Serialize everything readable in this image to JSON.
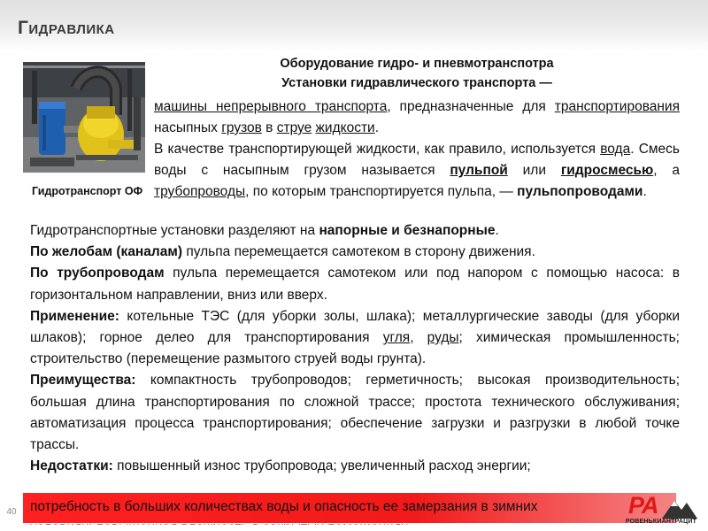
{
  "header": {
    "title": "Гидравлика"
  },
  "photo": {
    "caption": "Гидротранспорт ОФ"
  },
  "subtitle": {
    "line1": "Оборудование гидро- и пневмотранспотра",
    "line2": "Установки гидравлического транспорта —"
  },
  "intro": {
    "p1": {
      "l1": "машины непрерывного транспорта",
      "t1": ", предназначенные для ",
      "l2": "транспортирования",
      "t2": " насыпных ",
      "l3": "грузов",
      "t3": " в ",
      "l4": "струе",
      "t4": " ",
      "l5": "жидкости",
      "t5": "."
    },
    "p2": {
      "t1": "В качестве транспортирующей жидкости, как правило, используется ",
      "l1": "вода",
      "t2": ". Смесь воды с насыпным грузом называется ",
      "l2": "пульпой",
      "t3": " или ",
      "l3": "гидросмесью",
      "t4": ", а ",
      "l4": "трубопроводы",
      "t5": ", по которым транспортируется пульпа, — ",
      "b1": "пульпопроводами",
      "t6": "."
    }
  },
  "main": {
    "p1": {
      "t1": "Гидротранспортные установки разделяют на ",
      "b1": "напорные и безнапорные",
      "t2": "."
    },
    "p2": {
      "b1": "По желобам (каналам)",
      "t1": " пульпа перемещается самотеком в сторону движения."
    },
    "p3": {
      "b1": "По трубопроводам",
      "t1": " пульпа перемещается самотеком или под напором с помощью насоса: в горизонтальном направлении, вниз или вверх."
    },
    "p4": {
      "b1": "Применение:",
      "t1": " котельные ТЭС (для уборки золы, шлака); металлургические заводы (для уборки шлаков); горное делео для транспортирования ",
      "l1": "угля",
      "t2": ", ",
      "l2": "руды",
      "t3": "; химическая промышленность; строительство (перемещение размытого струей воды грунта)."
    },
    "p5": {
      "b1": "Преимущества:",
      "t1": " компактность трубопроводов; герметичность; высокая производительность; большая длина транспортирования по сложной трассе; простота технического обслуживания; автоматизация процесса транспортирования; обеспечение загрузки и разгрузки в любой точке трассы."
    },
    "p6": {
      "b1": "Недостатки:",
      "t1": " повышенный износ трубопровода; увеличенный расход энергии;"
    }
  },
  "footer": {
    "page_number": "40",
    "overflow_line1": "потребность в больших количествах воды и опасность ее замерзания в зимних",
    "overflow_line2": "условиях; повышенная влажность в закрытых помещениях.",
    "logo_mark": "PA",
    "logo_text": "РОВЕНЬКИАНТРАЦИТ",
    "bar_color": "#f21a1a"
  }
}
